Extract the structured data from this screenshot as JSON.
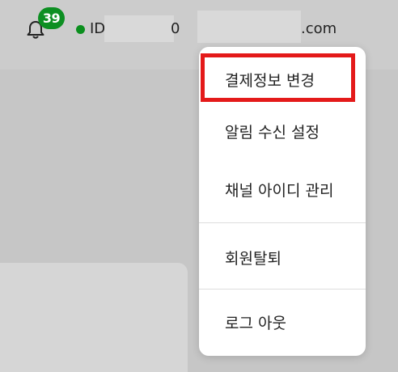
{
  "header": {
    "notification_count": "39",
    "user_id_prefix": "ID",
    "user_id_suffix": "0",
    "email_suffix": ".com",
    "status_color": "#0b8f1e",
    "badge_color": "#0d8f22"
  },
  "icons": {
    "bell": "bell-icon",
    "status": "online-status-dot"
  },
  "dropdown": {
    "items": [
      {
        "label": "결제정보 변경",
        "highlighted": true
      },
      {
        "label": "알림 수신 설정"
      },
      {
        "label": "채널 아이디 관리"
      },
      {
        "label": "회원탈퇴"
      },
      {
        "label": "로그 아웃"
      }
    ],
    "highlight_color": "#e41a1a"
  }
}
